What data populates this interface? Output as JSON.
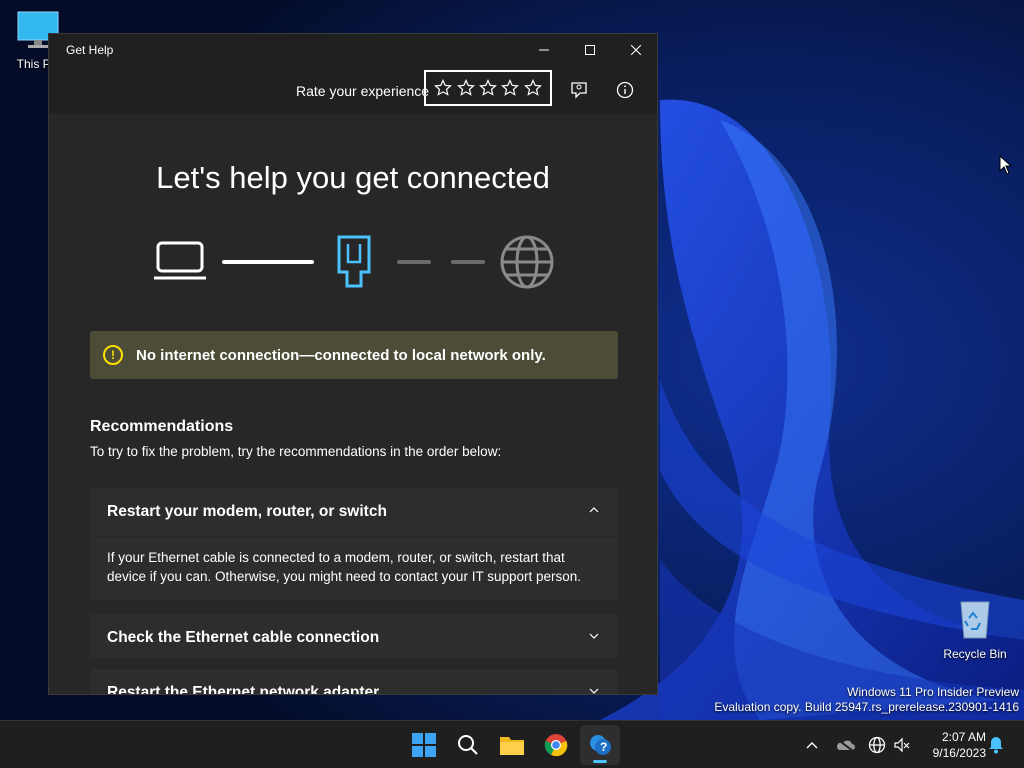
{
  "desktop": {
    "icons": [
      {
        "label": "This PC",
        "icon": "monitor-icon"
      },
      {
        "label": "Recycle Bin",
        "icon": "recycle-bin-icon"
      }
    ],
    "watermark": {
      "line1": "Windows 11 Pro Insider Preview",
      "line2": "Evaluation copy. Build 25947.rs_prerelease.230901-1416"
    }
  },
  "window": {
    "title": "Get Help",
    "controls": {
      "minimize": "minimize-icon",
      "maximize": "maximize-icon",
      "close": "close-icon"
    },
    "toolbar": {
      "rate_label": "Rate your experience",
      "stars": 5,
      "rating": 0,
      "feedback_icon": "feedback-icon",
      "info_icon": "info-icon"
    },
    "heading": "Let's help you get connected",
    "diagram": {
      "devices": [
        "laptop-icon",
        "ethernet-port-icon",
        "globe-icon"
      ],
      "accent": "#4cc2ff"
    },
    "warning": {
      "icon": "warning-icon",
      "text": "No internet connection—connected to local network only.",
      "color": "#fce100"
    },
    "recommendations": {
      "title": "Recommendations",
      "subtitle": "To try to fix the problem, try the recommendations in the order below:",
      "items": [
        {
          "title": "Restart your modem, router, or switch",
          "expanded": true,
          "body": "If your Ethernet cable is connected to a modem, router, or switch, restart that device if you can. Otherwise, you might need to contact your IT support person."
        },
        {
          "title": "Check the Ethernet cable connection",
          "expanded": false
        },
        {
          "title": "Restart the Ethernet network adapter",
          "expanded": false
        }
      ]
    }
  },
  "taskbar": {
    "apps": [
      "start-icon",
      "search-icon",
      "file-explorer-icon",
      "chrome-icon",
      "get-help-icon"
    ],
    "tray": [
      "chevron-up-icon",
      "onedrive-icon",
      "network-icon",
      "volume-muted-icon",
      "notification-bell-icon"
    ],
    "time": "2:07 AM",
    "date": "9/16/2023"
  }
}
